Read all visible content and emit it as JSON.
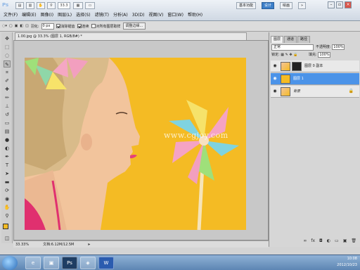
{
  "app": {
    "logo": "Ps"
  },
  "topbar": {
    "zoom_value": "33.3",
    "workspaces": [
      "基本功能",
      "设计",
      "绘画"
    ],
    "active_workspace": 1
  },
  "menu": [
    "文件(F)",
    "编辑(E)",
    "图像(I)",
    "图层(L)",
    "选择(S)",
    "滤镜(T)",
    "分析(A)",
    "3D(D)",
    "视图(V)",
    "窗口(W)",
    "帮助(H)"
  ],
  "options": {
    "feather_label": "羽化:",
    "feather_value": "0 px",
    "antialias_label": "消除锯齿",
    "contiguous_label": "连续",
    "all_layers_label": "对所有图层取样",
    "refine_label": "调整边缘..."
  },
  "document": {
    "tab_title": "1.00.jpg @ 33.3% (图层 1, RGB/8#) *",
    "watermark": "www.cgjoy.com",
    "status_zoom": "33.33%",
    "status_doc": "文档:6.12M/12.5M"
  },
  "panels": {
    "tabs": [
      "图层",
      "通道",
      "路径"
    ],
    "blend_mode": "正常",
    "opacity_label": "不透明度:",
    "opacity_value": "100%",
    "lock_label": "锁定:",
    "fill_label": "填充:",
    "fill_value": "100%",
    "layers": [
      {
        "name": "图层 0 副本",
        "selected": false
      },
      {
        "name": "图层 1",
        "selected": true
      },
      {
        "name": "背景",
        "selected": false
      }
    ]
  },
  "taskbar": {
    "time": "10:08",
    "date": "2012/10/23",
    "apps": [
      "e",
      "▣",
      "Ps",
      "◈",
      "W"
    ]
  },
  "colors": {
    "canvas_bg": "#f4bb24",
    "selected_layer": "#4b93e8"
  }
}
